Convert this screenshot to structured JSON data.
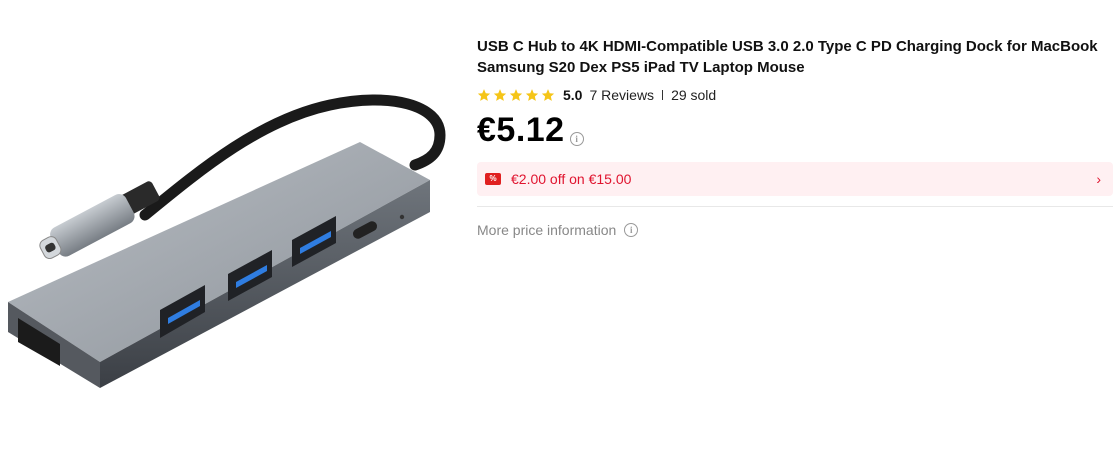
{
  "product": {
    "title": "USB C Hub to 4K HDMI-Compatible USB 3.0 2.0 Type C PD Charging Dock for MacBook Samsung S20 Dex PS5 iPad TV Laptop Mouse",
    "image_alt": "USB C hub with HDMI, USB 3.0 ports and Type C PD port"
  },
  "rating": {
    "stars": 5,
    "value": "5.0",
    "reviews_label": "7 Reviews",
    "sold_label": "29 sold",
    "star_color": "#f5c518"
  },
  "price": {
    "value": "€5.12",
    "info_icon": "info-circle-icon"
  },
  "coupon": {
    "badge_icon": "coupon-badge-icon",
    "badge_glyph": "%",
    "text": "€2.00 off on €15.00",
    "chevron": "›",
    "text_color": "#e0142f",
    "bg_color": "#fff0f2"
  },
  "more_price_info": {
    "label": "More price information",
    "info_icon": "info-circle-icon"
  }
}
